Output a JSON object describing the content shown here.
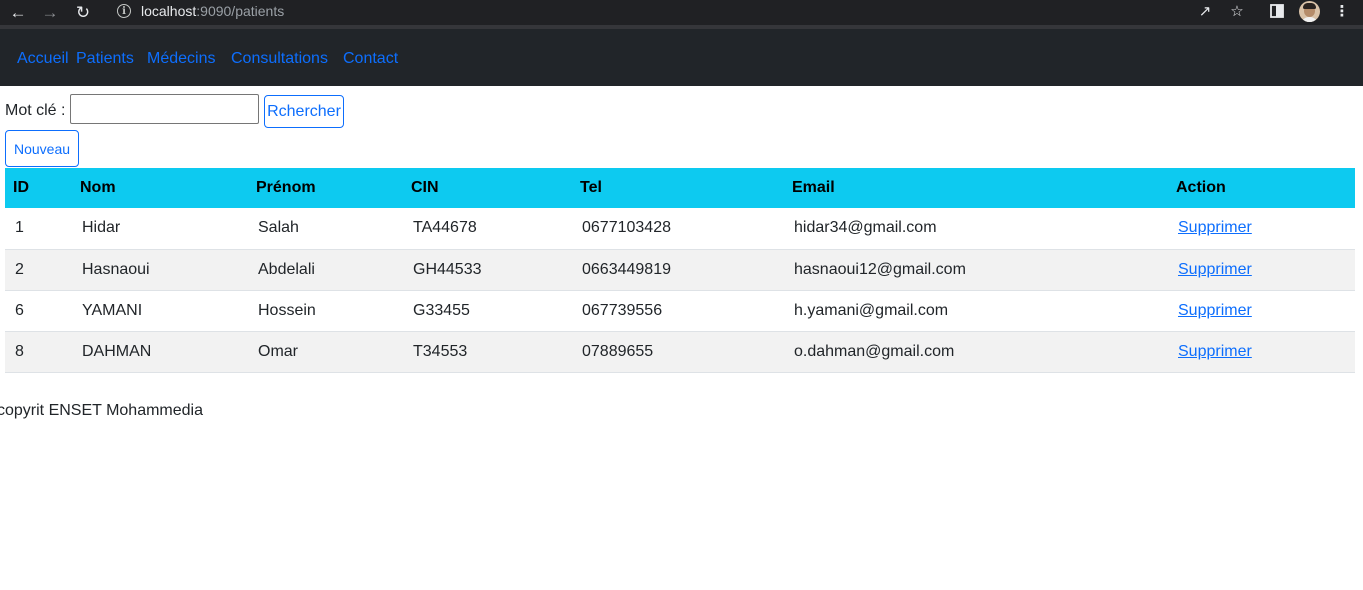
{
  "browser": {
    "url_host": "localhost",
    "url_rest": ":9090/patients",
    "icons": [
      "back-arrow-icon",
      "forward-arrow-icon",
      "reload-icon",
      "info-icon",
      "share-icon",
      "star-icon",
      "sidebar-icon",
      "profile-avatar",
      "menu-kebab-icon"
    ]
  },
  "nav": {
    "items": [
      "Accueil",
      "Patients",
      "Médecins",
      "Consultations",
      "Contact"
    ]
  },
  "search": {
    "label": "Mot clé :",
    "value": "",
    "button": "Rchercher"
  },
  "new_button": "Nouveau",
  "table": {
    "headers": [
      "ID",
      "Nom",
      "Prénom",
      "CIN",
      "Tel",
      "Email",
      "Action"
    ],
    "rows": [
      [
        "1",
        "Hidar",
        "Salah",
        "TA44678",
        "0677103428",
        "hidar34@gmail.com",
        "Supprimer"
      ],
      [
        "2",
        "Hasnaoui",
        "Abdelali",
        "GH44533",
        "0663449819",
        "hasnaoui12@gmail.com",
        "Supprimer"
      ],
      [
        "6",
        "YAMANI",
        "Hossein",
        "G33455",
        "067739556",
        "h.yamani@gmail.com",
        "Supprimer"
      ],
      [
        "8",
        "DAHMAN",
        "Omar",
        "T34553",
        "07889655",
        "o.dahman@gmail.com",
        "Supprimer"
      ]
    ]
  },
  "footer": "copyrit ENSET Mohammedia",
  "colors": {
    "navbar_bg": "#212529",
    "link": "#0d6efd",
    "table_header_bg": "#0dcaf0",
    "striped_row_bg": "#f2f2f2"
  }
}
